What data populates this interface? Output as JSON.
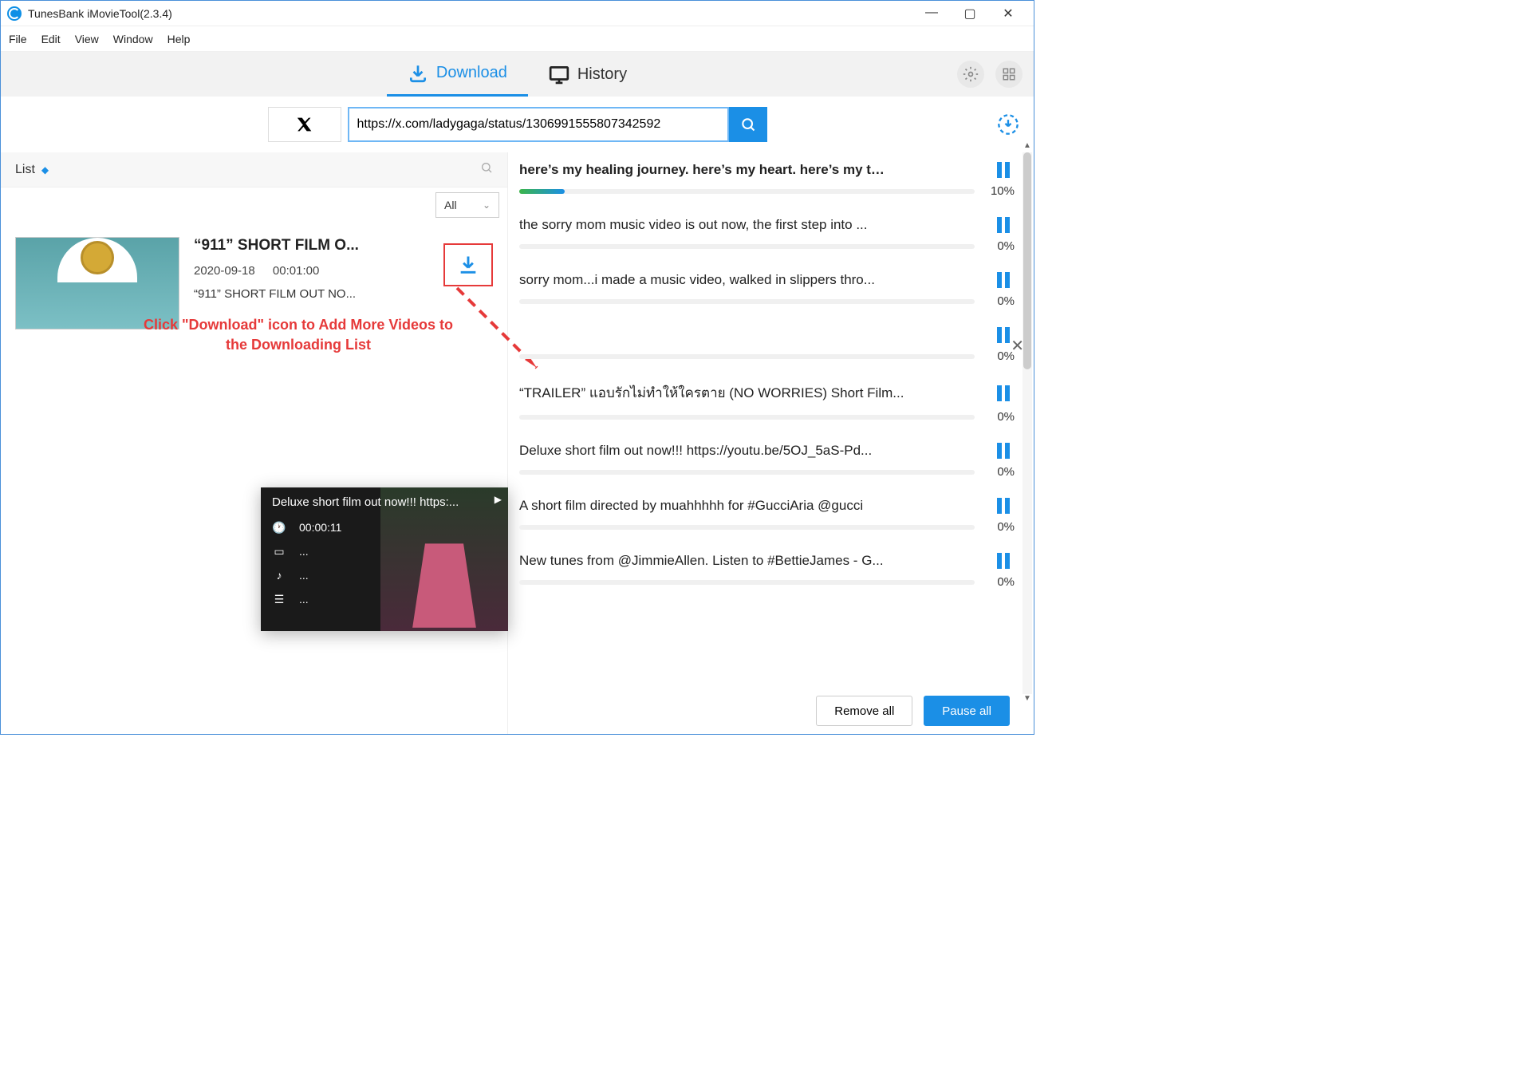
{
  "app_title": "TunesBank iMovieTool(2.3.4)",
  "menu": [
    "File",
    "Edit",
    "View",
    "Window",
    "Help"
  ],
  "tabs": {
    "download": "Download",
    "history": "History"
  },
  "url_value": "https://x.com/ladygaga/status/1306991555807342592",
  "list_header": "List",
  "filter_label": "All",
  "video": {
    "title": "“911” SHORT FILM O...",
    "date": "2020-09-18",
    "duration": "00:01:00",
    "desc": "“911” SHORT FILM OUT NO..."
  },
  "annotation_line1": "Click \"Download\" icon to Add More Videos to",
  "annotation_line2": "the Downloading List",
  "preview": {
    "title": "Deluxe short film out now!!! https:...",
    "time": "00:00:11",
    "ellipsis": "..."
  },
  "downloads": [
    {
      "title": "here’s my healing journey. here’s my heart. here’s my t…",
      "pct": "10%",
      "progress": 10,
      "bold": true
    },
    {
      "title": "the sorry mom music video is out now, the first step into ...",
      "pct": "0%",
      "progress": 0
    },
    {
      "title": "sorry mom...i made a music video, walked in slippers thro...",
      "pct": "0%",
      "progress": 0
    },
    {
      "title": "",
      "pct": "0%",
      "progress": 0
    },
    {
      "title": "“TRAILER” แอบรักไม่ทำให้ใครตาย (NO WORRIES) Short Film...",
      "pct": "0%",
      "progress": 0
    },
    {
      "title": "Deluxe short film out now!!! https://youtu.be/5OJ_5aS-Pd...",
      "pct": "0%",
      "progress": 0
    },
    {
      "title": "A short film directed by muahhhhh for #GucciAria @gucci",
      "pct": "0%",
      "progress": 0
    },
    {
      "title": "New tunes from @JimmieAllen. Listen to #BettieJames - G...",
      "pct": "0%",
      "progress": 0
    }
  ],
  "footer": {
    "remove": "Remove all",
    "pause": "Pause all"
  }
}
